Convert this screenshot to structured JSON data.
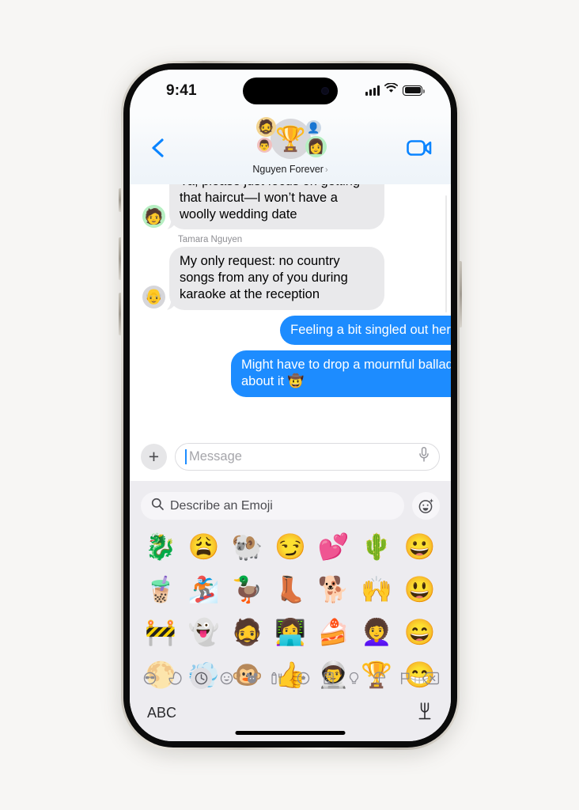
{
  "status_bar": {
    "time": "9:41",
    "signal_icon": "cellular-bars-icon",
    "wifi_icon": "wifi-icon",
    "battery_icon": "battery-full-icon"
  },
  "nav": {
    "back_icon": "back-chevron-icon",
    "facetime_icon": "video-camera-icon",
    "group_name": "Nguyen Forever",
    "group_chevron": "›",
    "avatars": {
      "main": "🏆",
      "small_1": "🧔",
      "small_2": "👨",
      "small_3": "👤",
      "small_4": "👩"
    }
  },
  "messages": [
    {
      "id": "msg-1",
      "direction": "incoming",
      "sender": "",
      "avatar": "🧑",
      "avatar_bg": "#b6efc2",
      "text": "Ya, please just focus on getting that haircut—I won’t have a woolly wedding date",
      "clipped_top": true
    },
    {
      "id": "msg-2",
      "direction": "incoming",
      "sender": "Tamara Nguyen",
      "avatar": "👴",
      "avatar_bg": "#d6d6da",
      "text": "My only request: no country songs from any of you during karaoke at the reception",
      "clipped_top": false
    },
    {
      "id": "msg-3",
      "direction": "outgoing",
      "sender": "",
      "avatar": "",
      "avatar_bg": "",
      "text": "Feeling a bit singled out here",
      "clipped_top": false
    },
    {
      "id": "msg-4",
      "direction": "outgoing",
      "sender": "",
      "avatar": "",
      "avatar_bg": "",
      "text": "Might have to drop a mournful ballad about it 🤠",
      "clipped_top": false
    }
  ],
  "compose": {
    "plus_icon": "plus-icon",
    "plus_label": "+",
    "placeholder": "Message",
    "mic_icon": "microphone-icon"
  },
  "keyboard": {
    "search_icon": "search-icon",
    "search_placeholder": "Describe an Emoji",
    "genmoji_icon": "genmoji-sparkle-icon",
    "emoji_rows": [
      [
        "🐉",
        "😩",
        "🐏",
        "😏",
        "💕",
        "🌵",
        "😀"
      ],
      [
        "🧋",
        "🏂",
        "🦆",
        "👢",
        "🐕",
        "🙌",
        "😃"
      ],
      [
        "🚧",
        "👻",
        "🧔",
        "👩‍💻",
        "🍰",
        "👩‍🦱",
        "😄"
      ],
      [
        "🌕",
        "💨",
        "🐵",
        "👍",
        "👨‍🚀",
        "🏆",
        "😁"
      ]
    ],
    "categories": [
      {
        "name": "memoji-sunglasses-icon",
        "selected": false
      },
      {
        "name": "stickers-icon",
        "selected": false
      },
      {
        "name": "clock-recents-icon",
        "selected": true
      },
      {
        "name": "smileys-icon",
        "selected": false
      },
      {
        "name": "animals-nature-icon",
        "selected": false
      },
      {
        "name": "food-drink-icon",
        "selected": false
      },
      {
        "name": "activities-icon",
        "selected": false
      },
      {
        "name": "travel-places-icon",
        "selected": false
      },
      {
        "name": "objects-icon",
        "selected": false
      },
      {
        "name": "symbols-icon",
        "selected": false
      },
      {
        "name": "flags-icon",
        "selected": false
      }
    ],
    "delete_icon": "delete-backspace-icon",
    "abc_label": "ABC",
    "dictate_icon": "dictation-microphone-icon"
  },
  "colors": {
    "bubble_outgoing": "#1d8cff",
    "bubble_incoming": "#e9e9eb",
    "keyboard_bg": "#edecf0",
    "accent": "#0a84ff"
  }
}
